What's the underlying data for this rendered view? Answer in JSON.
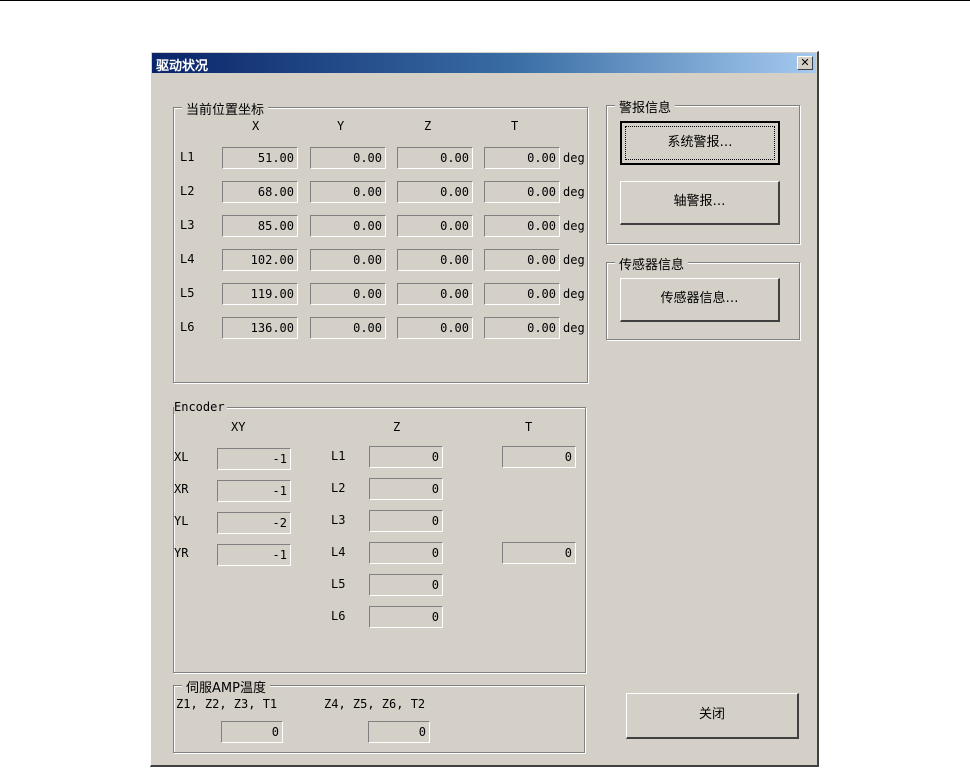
{
  "window": {
    "title": "驱动状况",
    "close_glyph": "✕"
  },
  "position": {
    "legend": "当前位置坐标",
    "headers": [
      "X",
      "Y",
      "Z",
      "T"
    ],
    "unit": "deg",
    "rows": [
      {
        "label": "L1",
        "values": [
          "51.00",
          "0.00",
          "0.00",
          "0.00"
        ]
      },
      {
        "label": "L2",
        "values": [
          "68.00",
          "0.00",
          "0.00",
          "0.00"
        ]
      },
      {
        "label": "L3",
        "values": [
          "85.00",
          "0.00",
          "0.00",
          "0.00"
        ]
      },
      {
        "label": "L4",
        "values": [
          "102.00",
          "0.00",
          "0.00",
          "0.00"
        ]
      },
      {
        "label": "L5",
        "values": [
          "119.00",
          "0.00",
          "0.00",
          "0.00"
        ]
      },
      {
        "label": "L6",
        "values": [
          "136.00",
          "0.00",
          "0.00",
          "0.00"
        ]
      }
    ]
  },
  "encoder": {
    "legend": "Encoder",
    "xy_header": "XY",
    "z_header": "Z",
    "t_header": "T",
    "xy": [
      {
        "label": "XL",
        "value": "-1"
      },
      {
        "label": "XR",
        "value": "-1"
      },
      {
        "label": "YL",
        "value": "-2"
      },
      {
        "label": "YR",
        "value": "-1"
      }
    ],
    "z": [
      {
        "label": "L1",
        "value": "0"
      },
      {
        "label": "L2",
        "value": "0"
      },
      {
        "label": "L3",
        "value": "0"
      },
      {
        "label": "L4",
        "value": "0"
      },
      {
        "label": "L5",
        "value": "0"
      },
      {
        "label": "L6",
        "value": "0"
      }
    ],
    "t": [
      "0",
      "0"
    ]
  },
  "servo": {
    "legend": "伺服AMP温度",
    "group1_label": "Z1, Z2, Z3, T1",
    "group1_value": "0",
    "group2_label": "Z4, Z5, Z6, T2",
    "group2_value": "0"
  },
  "alarm": {
    "legend": "警报信息",
    "system_button": "系统警报…",
    "axis_button": "轴警报…"
  },
  "sensor": {
    "legend": "传感器信息",
    "button": "传感器信息…"
  },
  "close_button": "关闭"
}
